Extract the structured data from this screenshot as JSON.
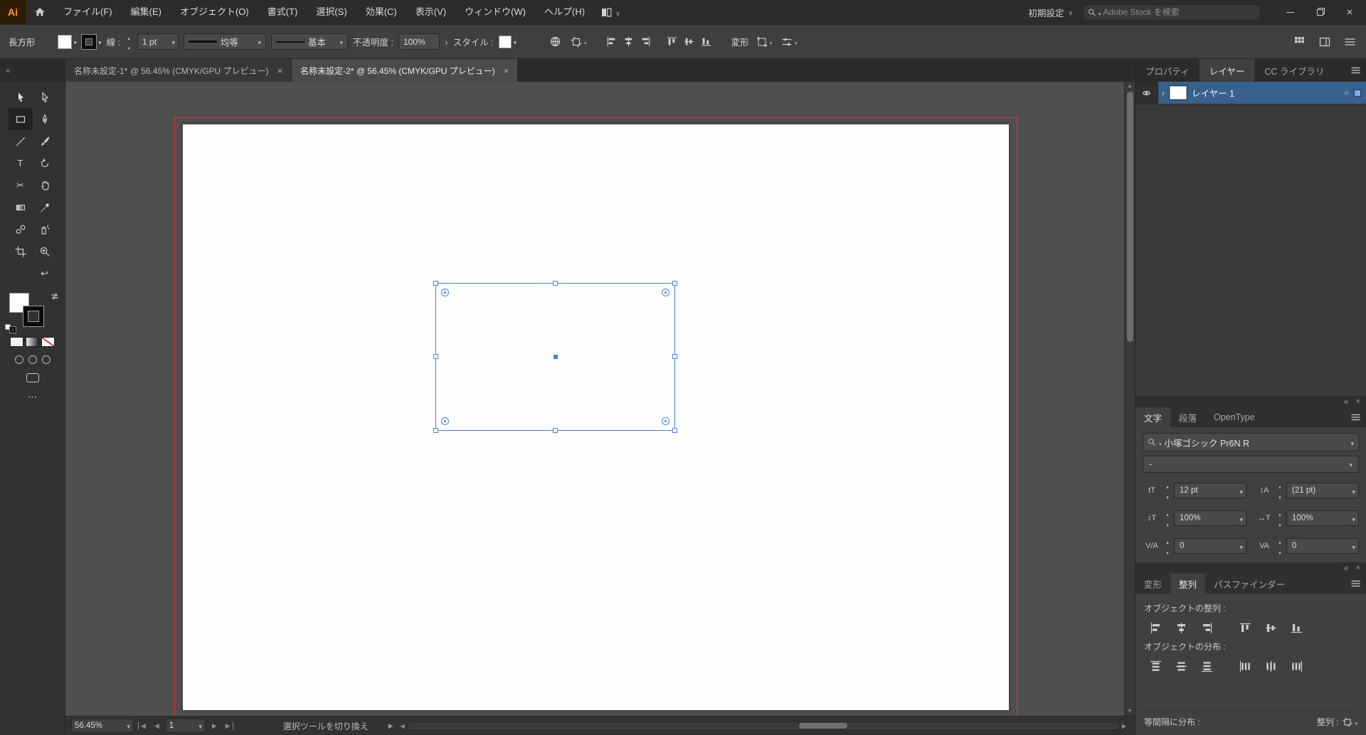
{
  "colors": {
    "selection_blue": "#4a7fd6",
    "layer_row_highlight": "#38618c",
    "bleed_red": "#dd3b3b",
    "logo_orange": "#ff9a2e",
    "artboard_white": "#fefefe"
  },
  "icons": {
    "dropdown_arrow": "▾",
    "chevron_down": "∨",
    "step_up": "▲",
    "step_down": "▼",
    "collapse_chevrons": "«",
    "panel_close": "×",
    "tab_close": "×",
    "more_dots": "⋯",
    "type_tool_glyph": "T",
    "scissors_tool_glyph": "✂",
    "rotate_view_glyph": "↩",
    "layer_target_circle": "○",
    "layer_expand_chevron": "›",
    "nav_prev": "◀",
    "nav_next": "▶",
    "search_magnifier": "svg-magnifier",
    "home": "svg-house",
    "eye": "svg-eye",
    "hamburger": "svg-three-lines"
  },
  "menubar": {
    "logo_text": "Ai",
    "menus": [
      "ファイル(F)",
      "編集(E)",
      "オブジェクト(O)",
      "書式(T)",
      "選択(S)",
      "効果(C)",
      "表示(V)",
      "ウィンドウ(W)",
      "ヘルプ(H)"
    ],
    "workspace_label": "初期設定",
    "search_placeholder": "Adobe Stock を検索"
  },
  "controlbar": {
    "context_label": "長方形",
    "stroke_label": "線 :",
    "stroke_weight": "1 pt",
    "width_profile": "均等",
    "brush_definition": "基本",
    "opacity_label": "不透明度 :",
    "opacity_value": "100%",
    "style_label": "スタイル :",
    "transform_label": "変形"
  },
  "document_tabs": [
    {
      "title": "名称未設定-1* @ 56.45% (CMYK/GPU プレビュー)",
      "active": false
    },
    {
      "title": "名称未設定-2* @ 56.45% (CMYK/GPU プレビュー)",
      "active": true
    }
  ],
  "dock": {
    "tabs": [
      "プロパティ",
      "レイヤー",
      "CC ライブラリ"
    ],
    "layers": {
      "layer_name": "レイヤー 1"
    },
    "character": {
      "tabs": [
        "文字",
        "段落",
        "OpenType"
      ],
      "font_family": "小塚ゴシック Pr6N R",
      "font_style": "-",
      "fields": [
        {
          "icon": "tT",
          "value": "12 pt"
        },
        {
          "icon": "↕A",
          "value": "(21 pt)"
        },
        {
          "icon": "↕T",
          "value": "100%"
        },
        {
          "icon": "↔T",
          "value": "100%"
        },
        {
          "icon": "V/A",
          "value": "0"
        },
        {
          "icon": "VA",
          "value": "0"
        }
      ]
    },
    "align": {
      "tabs": [
        "変形",
        "整列",
        "パスファインダー"
      ],
      "align_objects_label": "オブジェクトの整列 :",
      "distribute_objects_label": "オブジェクトの分布 :",
      "distribute_spacing_label": "等間隔に分布 :",
      "align_to_label": "整列 :"
    }
  },
  "statusbar": {
    "zoom": "56.45%",
    "artboard": "1",
    "hint": "選択ツールを切り換え"
  }
}
